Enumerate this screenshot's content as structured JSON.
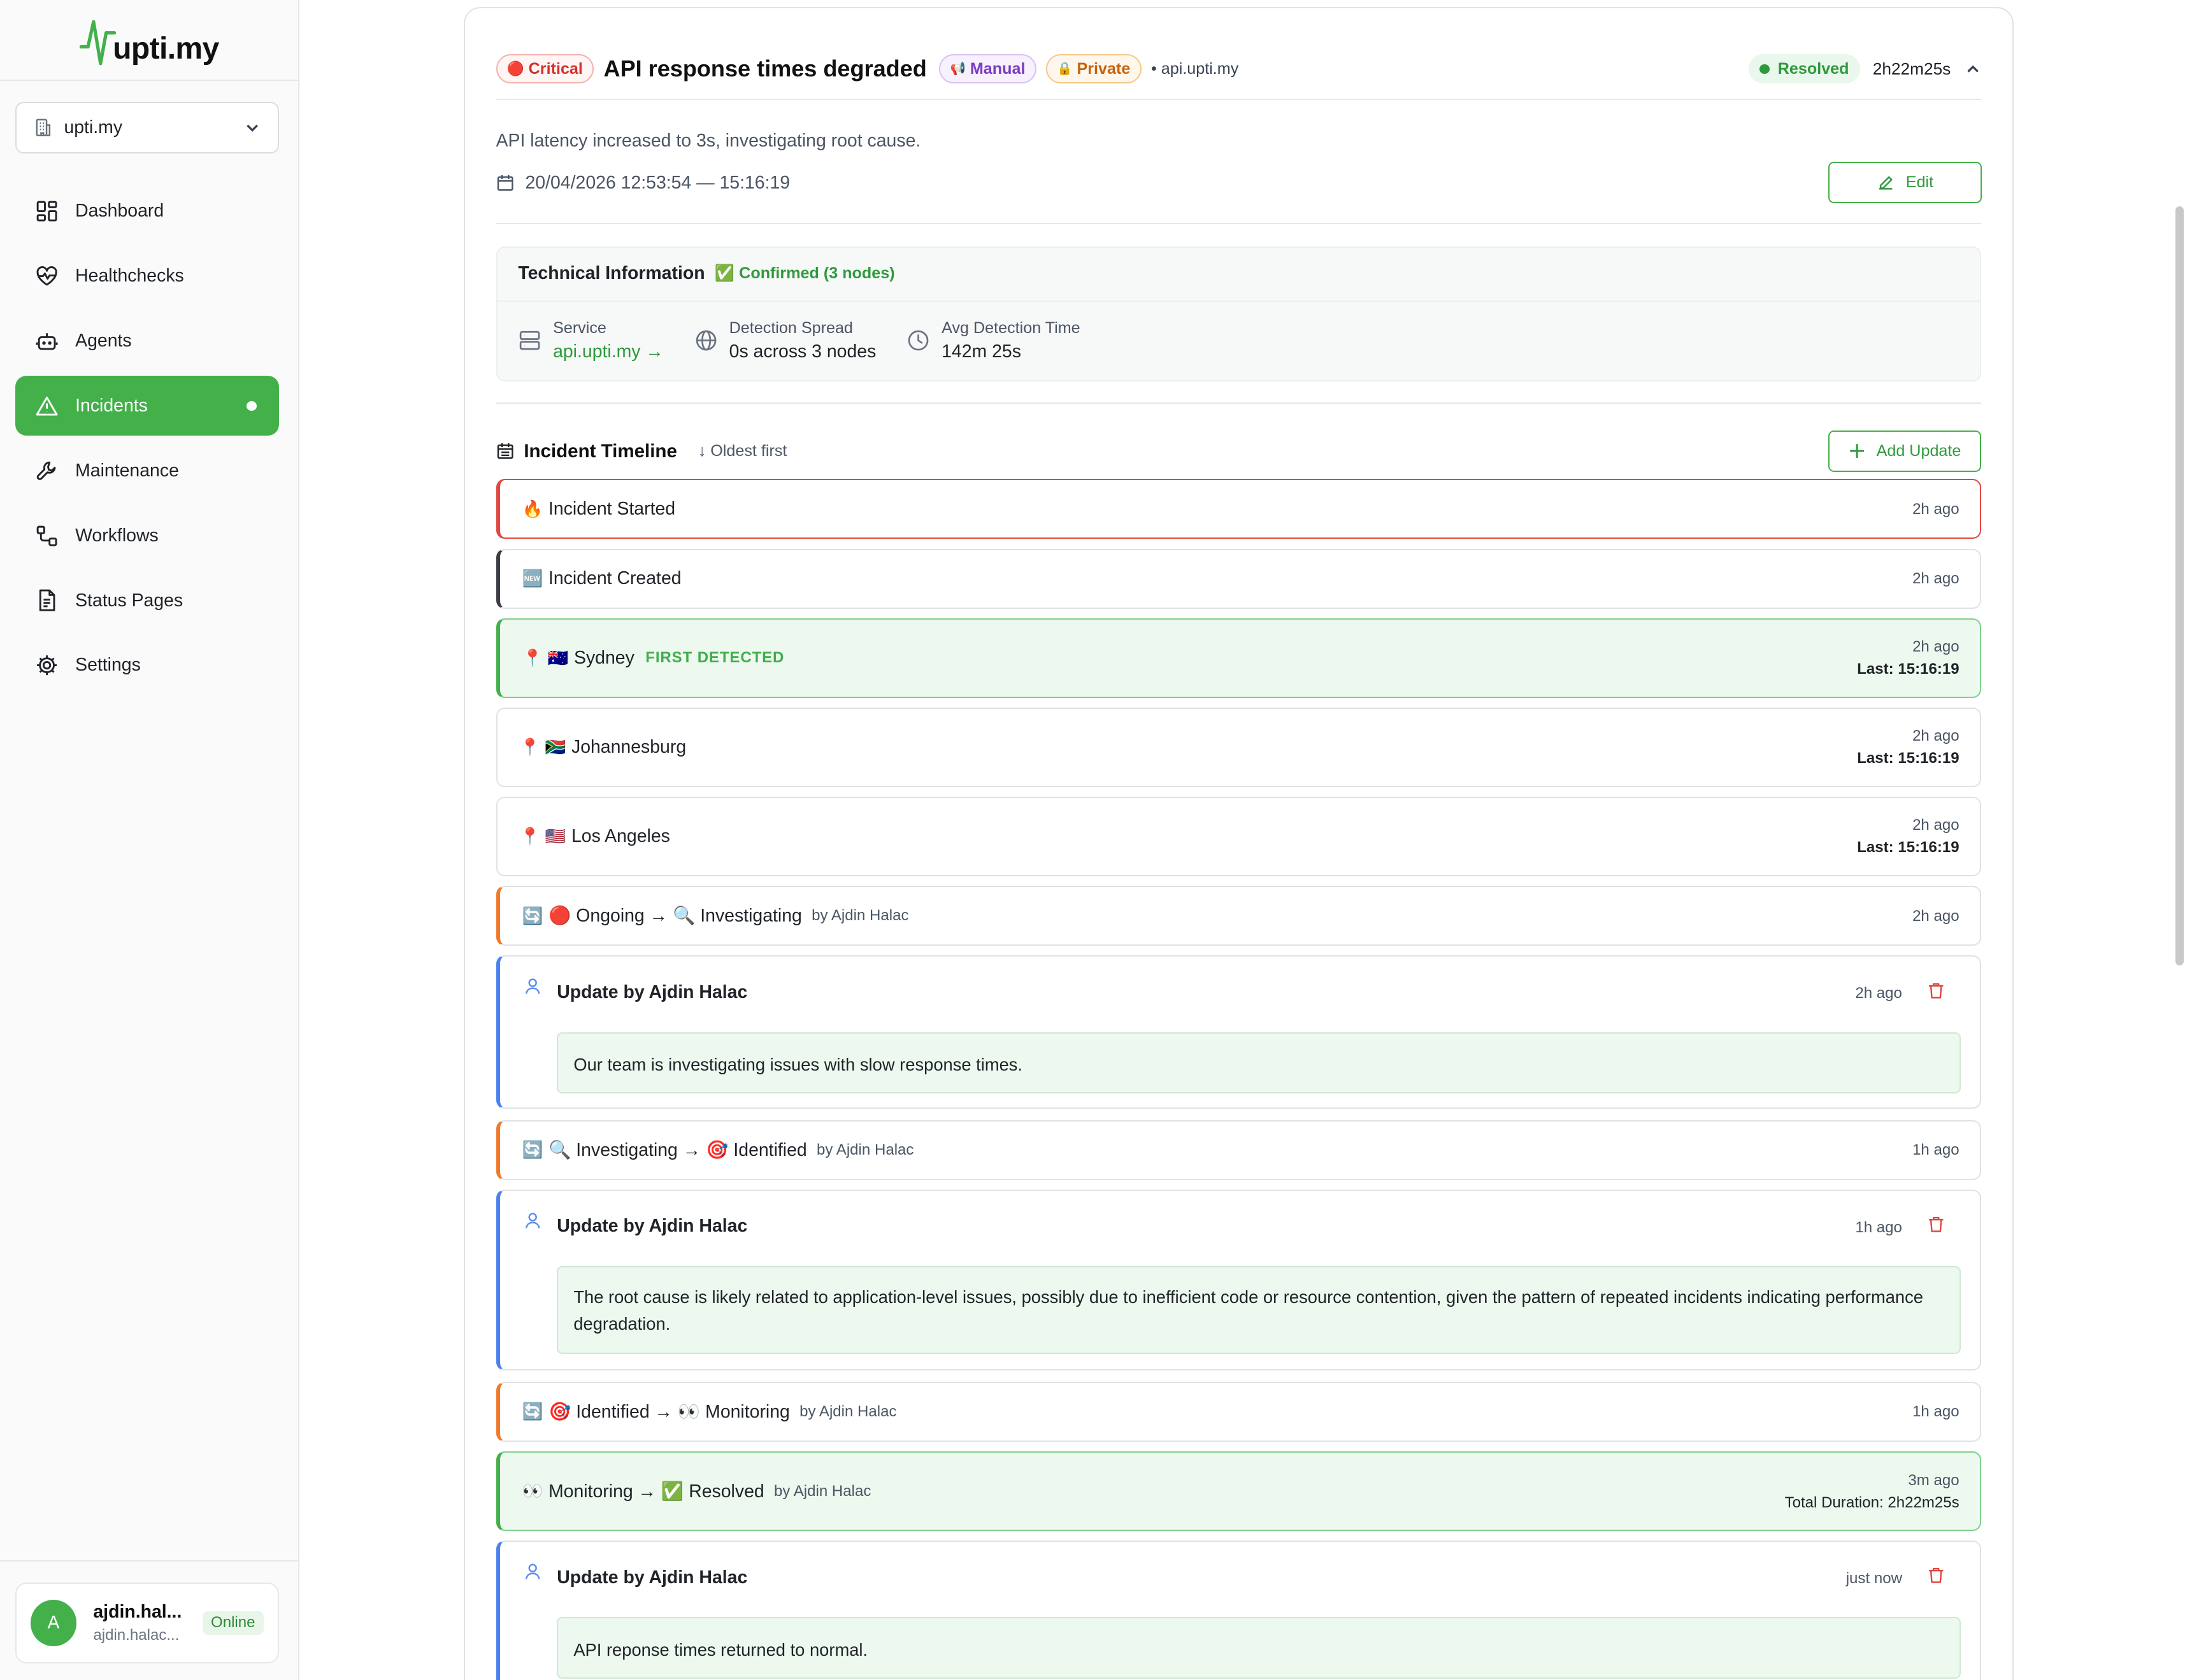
{
  "sidebar": {
    "logo_text": "upti.my",
    "workspace": "upti.my",
    "nav": [
      {
        "label": "Dashboard",
        "icon": "dashboard-icon"
      },
      {
        "label": "Healthchecks",
        "icon": "heart-pulse-icon"
      },
      {
        "label": "Agents",
        "icon": "bot-icon"
      },
      {
        "label": "Incidents",
        "icon": "alert-triangle-icon",
        "active": true
      },
      {
        "label": "Maintenance",
        "icon": "wrench-icon"
      },
      {
        "label": "Workflows",
        "icon": "workflow-icon"
      },
      {
        "label": "Status Pages",
        "icon": "file-text-icon"
      },
      {
        "label": "Settings",
        "icon": "gear-icon"
      }
    ],
    "user": {
      "initial": "A",
      "name": "ajdin.hal...",
      "email": "ajdin.halac...",
      "status": "Online"
    }
  },
  "incident": {
    "severity": "Critical",
    "severity_emoji": "🔴",
    "title": "API response times degraded",
    "type": "Manual",
    "type_emoji": "📢",
    "visibility": "Private",
    "visibility_emoji": "🔒",
    "host": "• api.upti.my",
    "status": "Resolved",
    "duration": "2h22m25s",
    "description": "API latency increased to 3s, investigating root cause.",
    "date_range": "20/04/2026 12:53:54 — 15:16:19",
    "edit_label": "Edit"
  },
  "tech": {
    "title": "Technical Information",
    "confirmed": "✅ Confirmed (3 nodes)",
    "service_label": "Service",
    "service_value": "api.upti.my →",
    "spread_label": "Detection Spread",
    "spread_value": "0s across 3 nodes",
    "avg_label": "Avg Detection Time",
    "avg_value": "142m 25s"
  },
  "timeline": {
    "title": "Incident Timeline",
    "sort": "↓ Oldest first",
    "add_label": "Add Update",
    "events": {
      "started": {
        "emoji": "🔥",
        "label": "Incident Started",
        "time": "2h ago"
      },
      "created": {
        "emoji": "🆕",
        "label": "Incident Created",
        "time": "2h ago"
      },
      "sydney": {
        "emoji": "📍 🇦🇺",
        "label": "Sydney",
        "tag": "FIRST DETECTED",
        "time": "2h ago",
        "last": "Last: 15:16:19"
      },
      "johannesburg": {
        "emoji": "📍 🇿🇦",
        "label": "Johannesburg",
        "time": "2h ago",
        "last": "Last: 15:16:19"
      },
      "losangeles": {
        "emoji": "📍 🇺🇸",
        "label": "Los Angeles",
        "time": "2h ago",
        "last": "Last: 15:16:19"
      },
      "change1": {
        "emoji": "🔄",
        "label": "🔴 Ongoing → 🔍 Investigating",
        "by": "by Ajdin Halac",
        "time": "2h ago"
      },
      "update1": {
        "title": "Update by Ajdin Halac",
        "time": "2h ago",
        "body": "Our team is investigating issues with slow response times."
      },
      "change2": {
        "emoji": "🔄",
        "label": "🔍 Investigating → 🎯 Identified",
        "by": "by Ajdin Halac",
        "time": "1h ago"
      },
      "update2": {
        "title": "Update by Ajdin Halac",
        "time": "1h ago",
        "body": "The root cause is likely related to application-level issues, possibly due to inefficient code or resource contention, given the pattern of repeated incidents indicating performance degradation."
      },
      "change3": {
        "emoji": "🔄",
        "label": "🎯 Identified → 👀 Monitoring",
        "by": "by Ajdin Halac",
        "time": "1h ago"
      },
      "resolved": {
        "emoji": "👀",
        "label": "Monitoring → ✅ Resolved",
        "by": "by Ajdin Halac",
        "time": "3m ago",
        "total": "Total Duration: 2h22m25s"
      },
      "update3": {
        "title": "Update by Ajdin Halac",
        "time": "just now",
        "body": "API reponse times returned to normal."
      }
    }
  },
  "colors": {
    "brand_green": "#43b04a",
    "critical_red": "#d2322b",
    "update_blue": "#4a82f0",
    "status_orange": "#ef7a2c"
  }
}
